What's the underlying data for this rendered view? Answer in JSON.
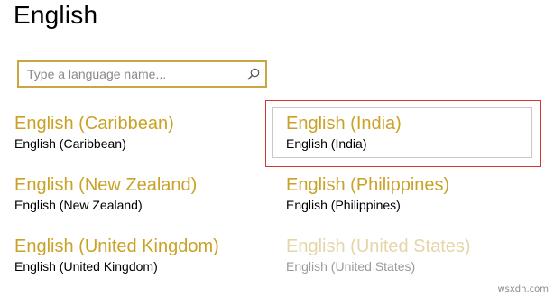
{
  "header": {
    "title": "English"
  },
  "search": {
    "placeholder": "Type a language name..."
  },
  "languages": [
    {
      "name": "English (Caribbean)",
      "native": "English (Caribbean)"
    },
    {
      "name": "English (India)",
      "native": "English (India)"
    },
    {
      "name": "English (New Zealand)",
      "native": "English (New Zealand)"
    },
    {
      "name": "English (Philippines)",
      "native": "English (Philippines)"
    },
    {
      "name": "English (United Kingdom)",
      "native": "English (United Kingdom)"
    },
    {
      "name": "English (United States)",
      "native": "English (United States)"
    }
  ],
  "selected_language": "English (India)",
  "watermark": "wsxdn.com",
  "colors": {
    "accent": "#c9a227",
    "search_border": "#c9a640",
    "selection_outline": "#d63333",
    "disabled_name": "#e4d6a8"
  }
}
